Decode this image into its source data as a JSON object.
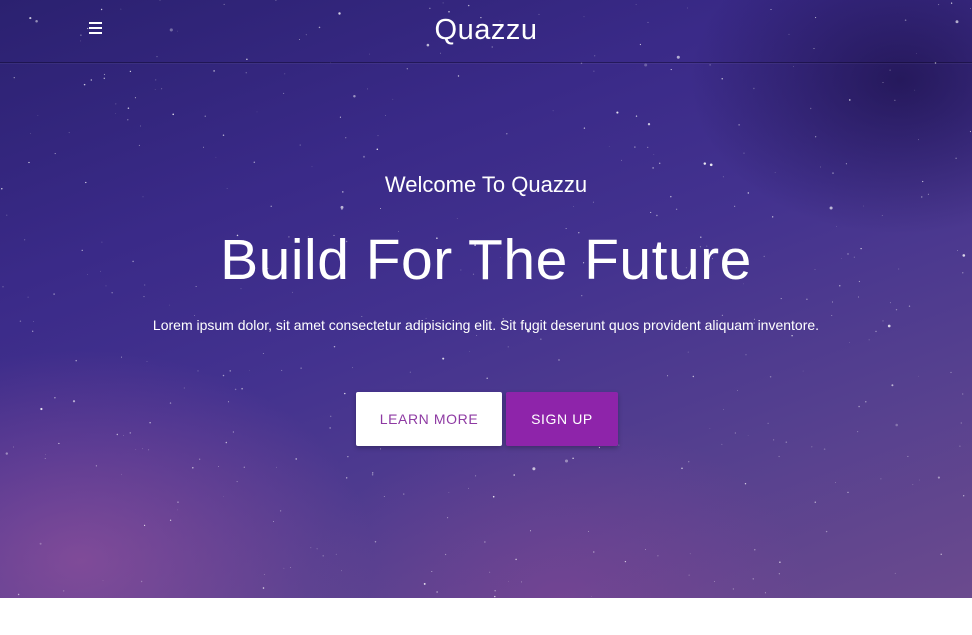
{
  "navbar": {
    "brand": "Quazzu",
    "menu_icon": "hamburger-menu-icon"
  },
  "hero": {
    "subtitle": "Welcome To Quazzu",
    "title": "Build For The Future",
    "description": "Lorem ipsum dolor, sit amet consectetur adipisicing elit. Sit fugit deserunt quos provident aliquam inventore.",
    "buttons": {
      "learn_more": "LEARN MORE",
      "sign_up": "SIGN UP"
    }
  },
  "colors": {
    "accent": "#8e24aa",
    "learn_more_text": "#8e3aa3",
    "hero_gradient_start": "#2b2170",
    "hero_gradient_end": "#6b4a8e"
  }
}
